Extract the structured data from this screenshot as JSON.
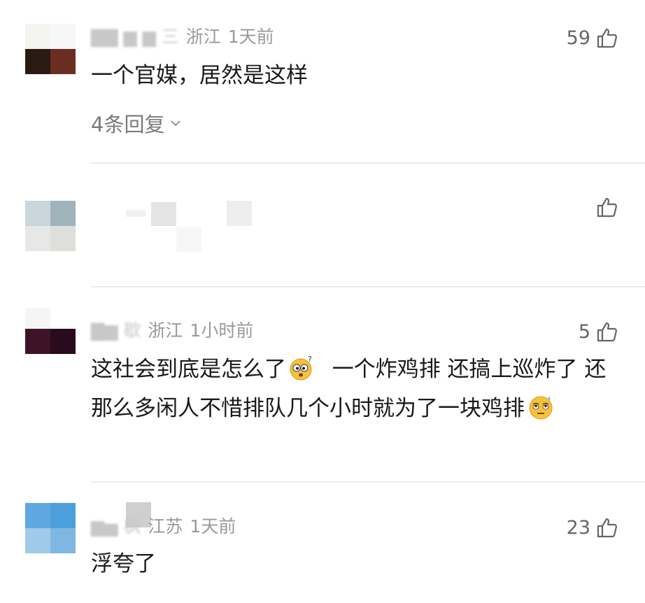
{
  "comments": [
    {
      "location": "浙江",
      "time": "1天前",
      "likes": "59",
      "text": "一个官媒，居然是这样",
      "replies": "4条回复"
    },
    {
      "location": "",
      "time": "",
      "likes": "",
      "text": ""
    },
    {
      "location": "浙江",
      "time": "1小时前",
      "likes": "5",
      "text_parts": [
        "这社会到底是怎么了",
        "  一个炸鸡排 还搞上巡炸了 还那么多闲人不惜排队几个小时就为了一块鸡排"
      ],
      "emojis": [
        "confused-face-emoji",
        "eye-roll-sweat-emoji"
      ]
    },
    {
      "location": "江苏",
      "time": "1天前",
      "likes": "23",
      "text": "浮夸了"
    }
  ],
  "icons": {
    "like": "thumbs-up-icon",
    "expand": "chevron-down-icon"
  },
  "colors": {
    "meta_text": "#9a9a9a",
    "body_text": "#1a1a1a",
    "divider": "#ececec"
  }
}
